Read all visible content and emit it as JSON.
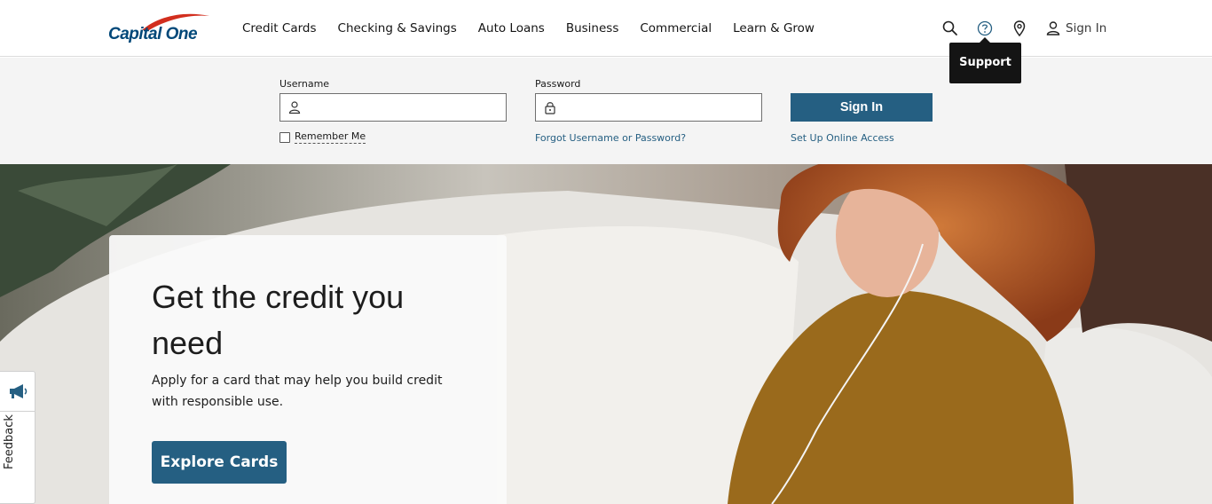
{
  "header": {
    "logo_text": "Capital One",
    "nav": [
      "Credit Cards",
      "Checking & Savings",
      "Auto Loans",
      "Business",
      "Commercial",
      "Learn & Grow"
    ],
    "icons": [
      "search-icon",
      "help-icon",
      "location-icon",
      "user-icon"
    ],
    "sign_in": "Sign In",
    "tooltip": "Support"
  },
  "login": {
    "username_label": "Username",
    "password_label": "Password",
    "username_value": "",
    "password_value": "",
    "sign_in_button": "Sign In",
    "remember_me": "Remember Me",
    "remember_checked": false,
    "forgot_link": "Forgot Username or Password?",
    "setup_link": "Set Up Online Access"
  },
  "hero": {
    "title": "Get the credit you need",
    "subtitle": "Apply for a card that may help you build credit with responsible use.",
    "button": "Explore Cards"
  },
  "feedback": {
    "label": "Feedback",
    "icon": "megaphone-icon"
  },
  "colors": {
    "brand_blue": "#255f82",
    "logo_blue": "#004879",
    "logo_red": "#d22e1e"
  }
}
